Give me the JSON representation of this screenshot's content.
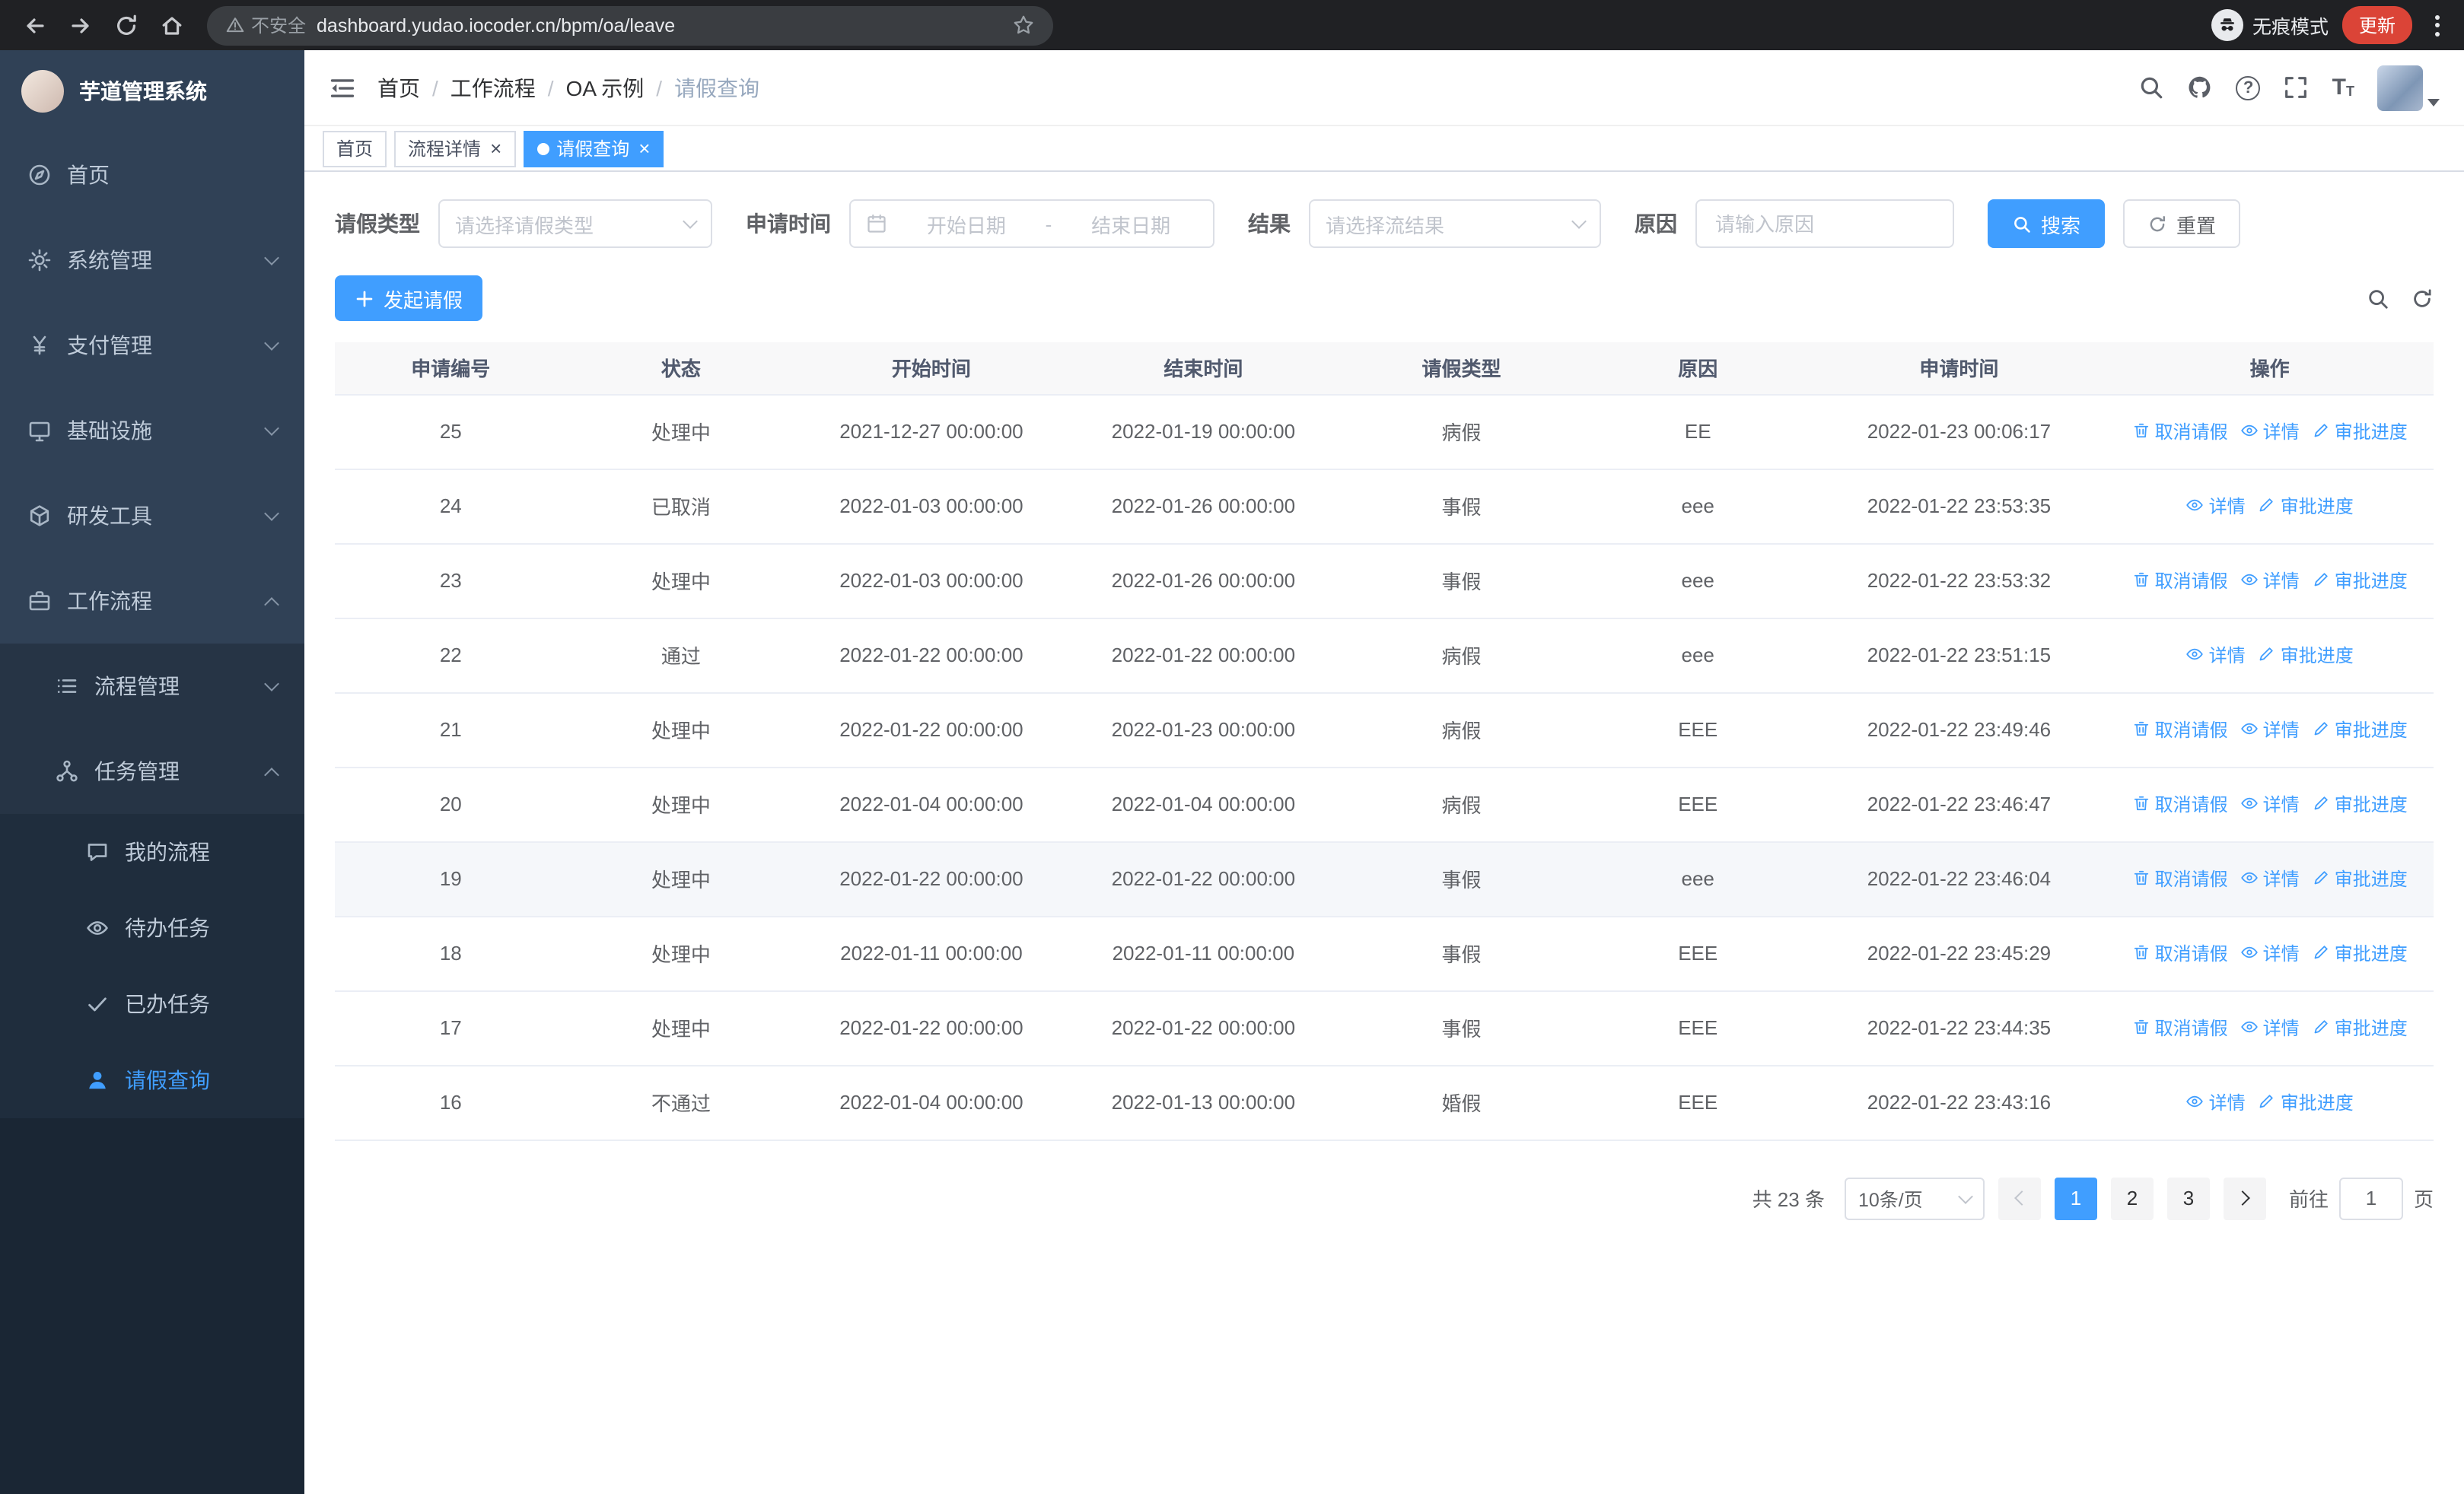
{
  "browser": {
    "security_warning": "不安全",
    "url": "dashboard.yudao.iocoder.cn/bpm/oa/leave",
    "incognito_label": "无痕模式",
    "update_button": "更新"
  },
  "colors": {
    "primary": "#409eff",
    "sidebar_bg": "#304156",
    "sidebar_sub_bg": "#1f2d3d",
    "chrome_bg": "#202124",
    "update_badge_bg": "#db4437"
  },
  "sidebar": {
    "logo_title": "芋道管理系统",
    "items": [
      {
        "label": "首页"
      },
      {
        "label": "系统管理"
      },
      {
        "label": "支付管理"
      },
      {
        "label": "基础设施"
      },
      {
        "label": "研发工具"
      },
      {
        "label": "工作流程"
      }
    ],
    "workflow_children": [
      {
        "label": "流程管理"
      },
      {
        "label": "任务管理"
      }
    ],
    "task_children": [
      {
        "label": "我的流程"
      },
      {
        "label": "待办任务"
      },
      {
        "label": "已办任务"
      },
      {
        "label": "请假查询"
      }
    ]
  },
  "header": {
    "breadcrumb": [
      "首页",
      "工作流程",
      "OA 示例",
      "请假查询"
    ]
  },
  "tabs": [
    {
      "label": "首页"
    },
    {
      "label": "流程详情"
    },
    {
      "label": "请假查询"
    }
  ],
  "filters": {
    "leave_type_label": "请假类型",
    "leave_type_placeholder": "请选择请假类型",
    "apply_time_label": "申请时间",
    "start_date_placeholder": "开始日期",
    "date_separator": "-",
    "end_date_placeholder": "结束日期",
    "result_label": "结果",
    "result_placeholder": "请选择流结果",
    "reason_label": "原因",
    "reason_placeholder": "请输入原因",
    "search_button": "搜索",
    "reset_button": "重置"
  },
  "toolbar": {
    "create_button": "发起请假"
  },
  "table": {
    "columns": [
      "申请编号",
      "状态",
      "开始时间",
      "结束时间",
      "请假类型",
      "原因",
      "申请时间",
      "操作"
    ],
    "action_labels": {
      "cancel": "取消请假",
      "detail": "详情",
      "progress": "审批进度"
    },
    "rows": [
      {
        "id": "25",
        "status": "处理中",
        "start": "2021-12-27 00:00:00",
        "end": "2022-01-19 00:00:00",
        "type": "病假",
        "reason": "EE",
        "applied": "2022-01-23 00:06:17",
        "actions": [
          "cancel",
          "detail",
          "progress"
        ]
      },
      {
        "id": "24",
        "status": "已取消",
        "start": "2022-01-03 00:00:00",
        "end": "2022-01-26 00:00:00",
        "type": "事假",
        "reason": "eee",
        "applied": "2022-01-22 23:53:35",
        "actions": [
          "detail",
          "progress"
        ]
      },
      {
        "id": "23",
        "status": "处理中",
        "start": "2022-01-03 00:00:00",
        "end": "2022-01-26 00:00:00",
        "type": "事假",
        "reason": "eee",
        "applied": "2022-01-22 23:53:32",
        "actions": [
          "cancel",
          "detail",
          "progress"
        ]
      },
      {
        "id": "22",
        "status": "通过",
        "start": "2022-01-22 00:00:00",
        "end": "2022-01-22 00:00:00",
        "type": "病假",
        "reason": "eee",
        "applied": "2022-01-22 23:51:15",
        "actions": [
          "detail",
          "progress"
        ]
      },
      {
        "id": "21",
        "status": "处理中",
        "start": "2022-01-22 00:00:00",
        "end": "2022-01-23 00:00:00",
        "type": "病假",
        "reason": "EEE",
        "applied": "2022-01-22 23:49:46",
        "actions": [
          "cancel",
          "detail",
          "progress"
        ]
      },
      {
        "id": "20",
        "status": "处理中",
        "start": "2022-01-04 00:00:00",
        "end": "2022-01-04 00:00:00",
        "type": "病假",
        "reason": "EEE",
        "applied": "2022-01-22 23:46:47",
        "actions": [
          "cancel",
          "detail",
          "progress"
        ]
      },
      {
        "id": "19",
        "status": "处理中",
        "start": "2022-01-22 00:00:00",
        "end": "2022-01-22 00:00:00",
        "type": "事假",
        "reason": "eee",
        "applied": "2022-01-22 23:46:04",
        "actions": [
          "cancel",
          "detail",
          "progress"
        ],
        "highlighted": true
      },
      {
        "id": "18",
        "status": "处理中",
        "start": "2022-01-11 00:00:00",
        "end": "2022-01-11 00:00:00",
        "type": "事假",
        "reason": "EEE",
        "applied": "2022-01-22 23:45:29",
        "actions": [
          "cancel",
          "detail",
          "progress"
        ]
      },
      {
        "id": "17",
        "status": "处理中",
        "start": "2022-01-22 00:00:00",
        "end": "2022-01-22 00:00:00",
        "type": "事假",
        "reason": "EEE",
        "applied": "2022-01-22 23:44:35",
        "actions": [
          "cancel",
          "detail",
          "progress"
        ]
      },
      {
        "id": "16",
        "status": "不通过",
        "start": "2022-01-04 00:00:00",
        "end": "2022-01-13 00:00:00",
        "type": "婚假",
        "reason": "EEE",
        "applied": "2022-01-22 23:43:16",
        "actions": [
          "detail",
          "progress"
        ]
      }
    ]
  },
  "pagination": {
    "total": "共 23 条",
    "page_size": "10条/页",
    "pages": [
      "1",
      "2",
      "3"
    ],
    "active_page": "1",
    "goto_label": "前往",
    "goto_value": "1",
    "goto_suffix": "页"
  }
}
